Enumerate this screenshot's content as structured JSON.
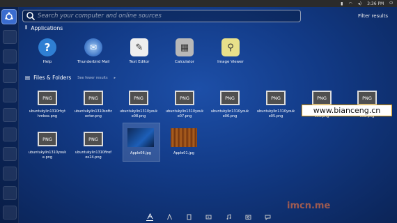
{
  "topbar": {
    "time": "3:36 PM"
  },
  "search": {
    "placeholder": "Search your computer and online sources",
    "value": ""
  },
  "filter": {
    "label": "Filter results"
  },
  "applications": {
    "heading": "Applications",
    "items": [
      {
        "label": "Help",
        "icon": "help-icon"
      },
      {
        "label": "Thunderbird Mail",
        "icon": "thunderbird-icon"
      },
      {
        "label": "Text Editor",
        "icon": "text-editor-icon"
      },
      {
        "label": "Calculator",
        "icon": "calculator-icon"
      },
      {
        "label": "Image Viewer",
        "icon": "image-viewer-icon"
      }
    ]
  },
  "files": {
    "heading": "Files & Folders",
    "see_fewer": "See fewer results",
    "png_badge": "PNG",
    "row1": [
      {
        "line1": "ubuntukylin1310rhyt",
        "line2": "hmbox.png"
      },
      {
        "line1": "ubuntukylin1310softc",
        "line2": "enter.png"
      },
      {
        "line1": "ubuntukylin1310youk",
        "line2": "e08.png"
      },
      {
        "line1": "ubuntukylin1310youk",
        "line2": "e07.png"
      },
      {
        "line1": "ubuntukylin1310youk",
        "line2": "e06.png"
      },
      {
        "line1": "ubuntukylin1310youk",
        "line2": "e05.png"
      },
      {
        "line1": "",
        "line2": "e03.png"
      },
      {
        "line1": "",
        "line2": "e02.png"
      }
    ],
    "row2": [
      {
        "line1": "ubuntukylin1310youk",
        "line2": "e.png"
      },
      {
        "line1": "ubuntukylin1310firef",
        "line2": "ox24.png"
      }
    ],
    "thumbs": [
      {
        "label": "Apple06.jpg"
      },
      {
        "label": "Apple01.jpg"
      }
    ]
  },
  "watermark": "www.bianceng.cn",
  "brand_mark": "imcn.me",
  "colors": {
    "background": "#123a86",
    "topbar": "#2b2b2b",
    "launcher_home": "#3a6ccf"
  }
}
